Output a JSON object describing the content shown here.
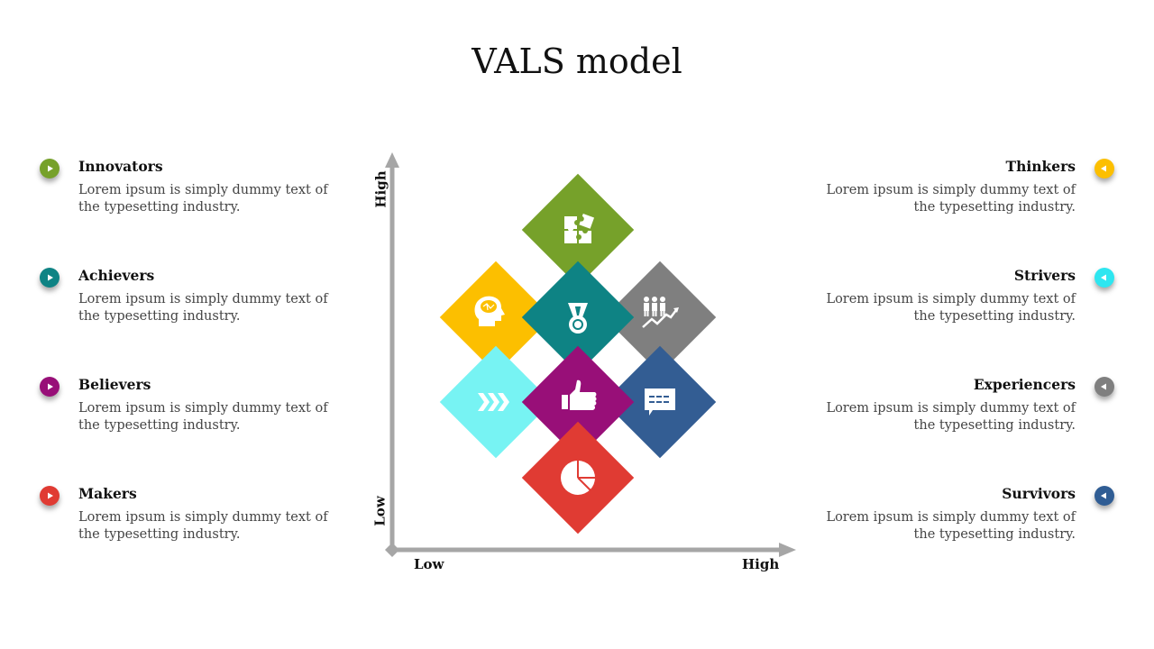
{
  "title": "VALS model",
  "axes": {
    "y_high": "High",
    "y_low": "Low",
    "x_low": "Low",
    "x_high": "High",
    "color": "#a6a6a6"
  },
  "left_items": [
    {
      "label": "Innovators",
      "text": "Lorem ipsum is simply dummy text of the typesetting industry.",
      "color": "#76a12a",
      "icon": "play-right-icon"
    },
    {
      "label": "Achievers",
      "text": "Lorem ipsum is simply dummy text of the typesetting industry.",
      "color": "#0e8384",
      "icon": "play-right-icon"
    },
    {
      "label": "Believers",
      "text": "Lorem ipsum is simply dummy text of the typesetting industry.",
      "color": "#980f78",
      "icon": "play-right-icon"
    },
    {
      "label": "Makers",
      "text": "Lorem ipsum is simply dummy text of the typesetting industry.",
      "color": "#e03b33",
      "icon": "play-right-icon"
    }
  ],
  "right_items": [
    {
      "label": "Thinkers",
      "text": "Lorem ipsum is simply dummy text of the typesetting industry.",
      "color": "#fcbf00",
      "icon": "play-left-icon"
    },
    {
      "label": "Strivers",
      "text": "Lorem ipsum is simply dummy text of the typesetting industry.",
      "color": "#2ee6f0",
      "icon": "play-left-icon"
    },
    {
      "label": "Experiencers",
      "text": "Lorem ipsum is simply dummy text of the typesetting industry.",
      "color": "#7f7f7f",
      "icon": "play-left-icon"
    },
    {
      "label": "Survivors",
      "text": "Lorem ipsum is simply dummy text of the typesetting industry.",
      "color": "#305d94",
      "icon": "play-left-icon"
    }
  ],
  "diamonds": [
    {
      "segment": "Innovators",
      "color": "#76a12a",
      "icon": "puzzle-icon"
    },
    {
      "segment": "Thinkers",
      "color": "#fcbf00",
      "icon": "brain-head-icon"
    },
    {
      "segment": "Achievers",
      "color": "#0e8384",
      "icon": "medal-icon"
    },
    {
      "segment": "Experiencers",
      "color": "#7f7f7f",
      "icon": "people-growth-icon"
    },
    {
      "segment": "Strivers",
      "color": "#77f3f3",
      "icon": "chevrons-right-icon"
    },
    {
      "segment": "Believers",
      "color": "#980f78",
      "icon": "thumbs-up-icon"
    },
    {
      "segment": "Survivors",
      "color": "#335d93",
      "icon": "chat-bubble-icon"
    },
    {
      "segment": "Makers",
      "color": "#e03b33",
      "icon": "pie-chart-icon"
    }
  ]
}
